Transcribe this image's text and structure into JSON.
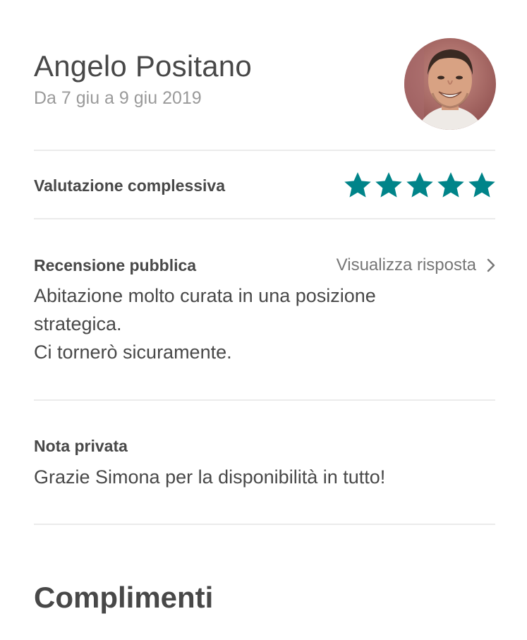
{
  "guest": {
    "name": "Angelo Positano",
    "dates": "Da 7 giu a 9 giu 2019"
  },
  "overall": {
    "label": "Valutazione complessiva",
    "stars": 5,
    "max_stars": 5,
    "star_color": "#008489"
  },
  "public_review": {
    "title": "Recensione pubblica",
    "link_label": "Visualizza risposta",
    "lines": [
      "Abitazione molto curata in una posizione",
      "strategica.",
      "Ci tornerò sicuramente."
    ]
  },
  "private_note": {
    "title": "Nota privata",
    "text": "Grazie Simona per la disponibilità in tutto!"
  },
  "compliments": {
    "title": "Complimenti"
  }
}
